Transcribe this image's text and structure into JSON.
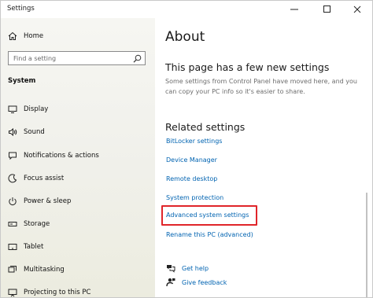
{
  "window": {
    "title": "Settings"
  },
  "sidebar": {
    "home_label": "Home",
    "search_placeholder": "Find a setting",
    "section_label": "System",
    "items": [
      {
        "label": "Display",
        "icon": "display-icon"
      },
      {
        "label": "Sound",
        "icon": "sound-icon"
      },
      {
        "label": "Notifications & actions",
        "icon": "notifications-icon"
      },
      {
        "label": "Focus assist",
        "icon": "focus-assist-icon"
      },
      {
        "label": "Power & sleep",
        "icon": "power-icon"
      },
      {
        "label": "Storage",
        "icon": "storage-icon"
      },
      {
        "label": "Tablet",
        "icon": "tablet-icon"
      },
      {
        "label": "Multitasking",
        "icon": "multitasking-icon"
      },
      {
        "label": "Projecting to this PC",
        "icon": "projecting-icon"
      }
    ]
  },
  "main": {
    "title": "About",
    "notice_heading": "This page has a few new settings",
    "notice_text": "Some settings from Control Panel have moved here, and you can copy your PC info so it's easier to share.",
    "related_heading": "Related settings",
    "related_links": [
      "BitLocker settings",
      "Device Manager",
      "Remote desktop",
      "System protection",
      "Advanced system settings",
      "Rename this PC (advanced)"
    ],
    "help_links": [
      {
        "label": "Get help",
        "icon": "get-help-icon"
      },
      {
        "label": "Give feedback",
        "icon": "give-feedback-icon"
      }
    ]
  },
  "colors": {
    "link": "#0063b1",
    "highlight": "#e0252a",
    "sidebar_bg": "#f2f2ec"
  }
}
